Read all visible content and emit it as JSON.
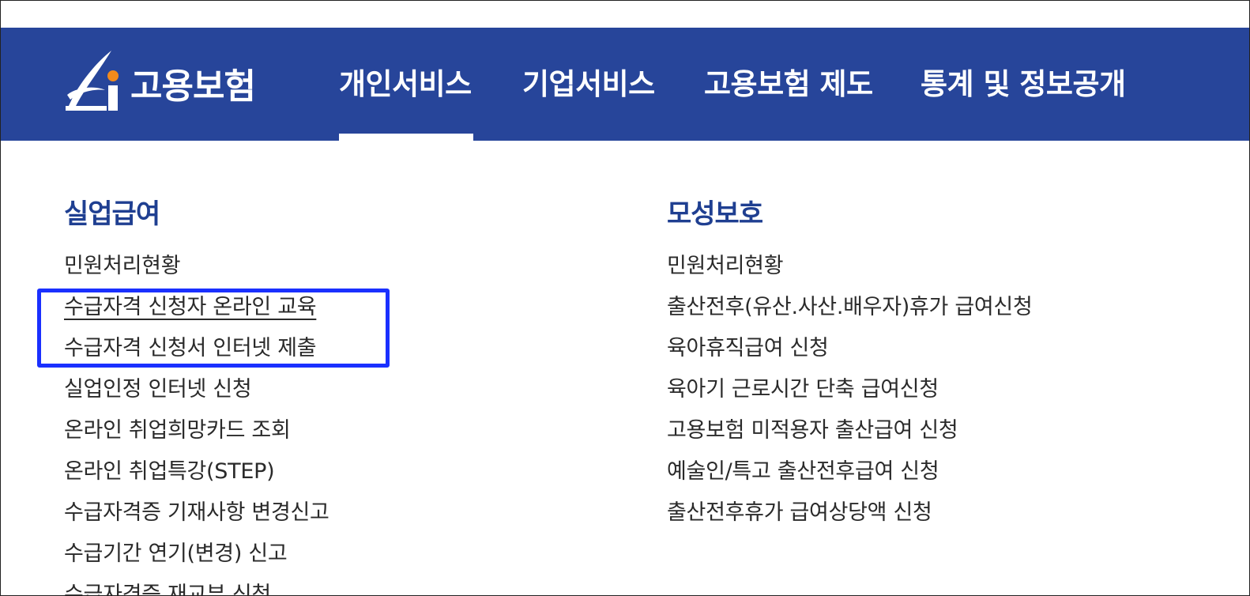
{
  "header": {
    "logo_text": "고용보험",
    "nav": [
      {
        "label": "개인서비스",
        "active": true
      },
      {
        "label": "기업서비스",
        "active": false
      },
      {
        "label": "고용보험 제도",
        "active": false
      },
      {
        "label": "통계 및 정보공개",
        "active": false
      }
    ]
  },
  "columns": [
    {
      "title": "실업급여",
      "items": [
        "민원처리현황",
        "수급자격 신청자 온라인 교육",
        "수급자격 신청서 인터넷 제출",
        "실업인정 인터넷 신청",
        "온라인 취업희망카드 조회",
        "온라인 취업특강(STEP)",
        "수급자격증 기재사항 변경신고",
        "수급기간 연기(변경) 신고",
        "수급자격증 재교부 신청"
      ]
    },
    {
      "title": "모성보호",
      "items": [
        "민원처리현황",
        "출산전후(유산.사산.배우자)휴가 급여신청",
        "육아휴직급여 신청",
        "육아기 근로시간 단축 급여신청",
        "고용보험 미적용자 출산급여 신청",
        "예술인/특고 출산전후급여 신청",
        "출산전후휴가 급여상당액 신청"
      ]
    }
  ],
  "colors": {
    "nav_bg": "#27459a",
    "title_color": "#1f3f91",
    "highlight_border": "#1a30ff",
    "logo_accent": "#f28a1c"
  }
}
